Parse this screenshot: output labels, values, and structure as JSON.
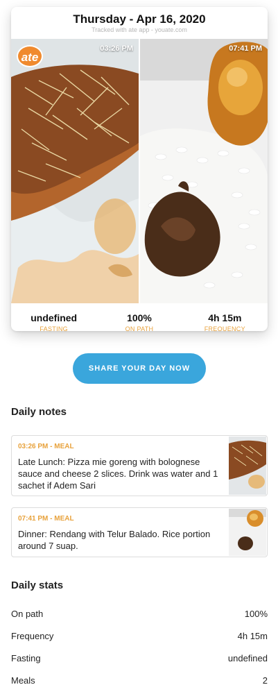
{
  "card": {
    "title": "Thursday - Apr 16, 2020",
    "subtitle": "Tracked with ate app - youate.com",
    "logo_text": "ate",
    "photos": [
      {
        "time": "03:26 PM"
      },
      {
        "time": "07:41 PM"
      }
    ],
    "metrics": [
      {
        "value": "undefined",
        "label": "FASTING"
      },
      {
        "value": "100%",
        "label": "ON PATH"
      },
      {
        "value": "4h 15m",
        "label": "FREQUENCY"
      }
    ]
  },
  "share_button": "SHARE YOUR DAY NOW",
  "notes_title": "Daily notes",
  "notes": [
    {
      "meta": "03:26 PM - MEAL",
      "text": "Late Lunch: Pizza mie goreng with bolognese sauce and cheese 2 slices. Drink was water and 1 sachet if Adem Sari"
    },
    {
      "meta": "07:41 PM - MEAL",
      "text": "Dinner: Rendang with Telur Balado. Rice portion around 7 suap."
    }
  ],
  "stats_title": "Daily stats",
  "stats": [
    {
      "label": "On path",
      "value": "100%"
    },
    {
      "label": "Frequency",
      "value": "4h 15m"
    },
    {
      "label": "Fasting",
      "value": "undefined"
    },
    {
      "label": "Meals",
      "value": "2"
    }
  ],
  "colors": {
    "accent": "#e8a23c",
    "share": "#3aa6dc",
    "logo": "#f08a2e"
  }
}
